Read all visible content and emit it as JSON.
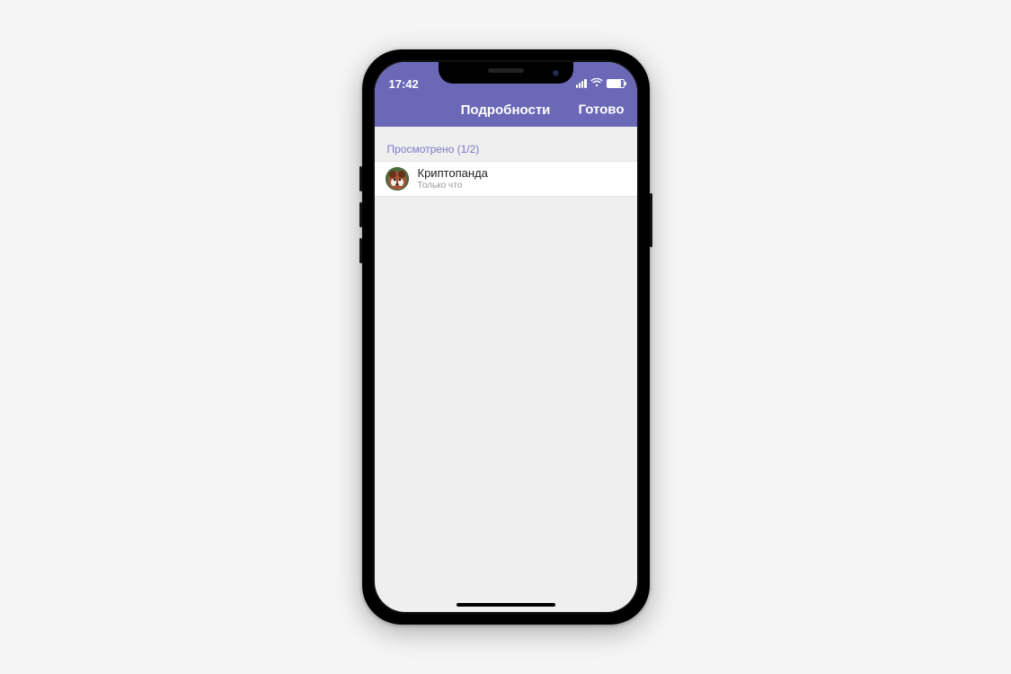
{
  "statusbar": {
    "time": "17:42"
  },
  "navbar": {
    "title": "Подробности",
    "done": "Готово"
  },
  "section": {
    "header": "Просмотрено (1/2)"
  },
  "list": {
    "items": [
      {
        "name": "Криптопанда",
        "subtitle": "Только что",
        "avatar_icon": "red-panda-avatar"
      }
    ]
  },
  "colors": {
    "accent": "#6a68b7"
  }
}
